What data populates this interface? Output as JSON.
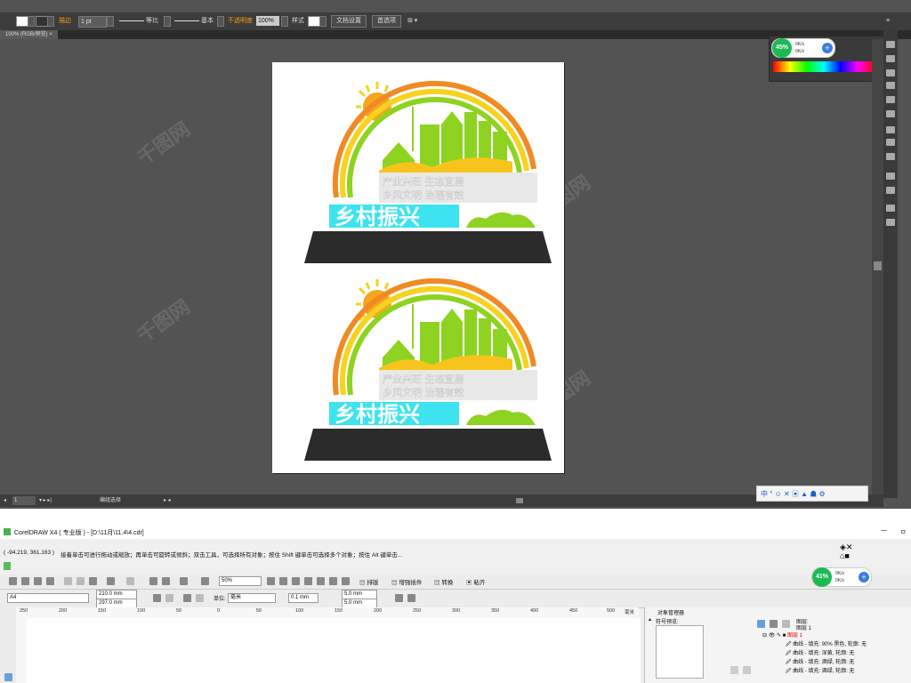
{
  "illustrator": {
    "control_bar": {
      "stroke_label": "描边",
      "stroke_weight": "1 pt",
      "profile_label": "等比",
      "brush_label": "基本",
      "opacity_label": "不透明度",
      "opacity_value": "100%",
      "style_label": "样式",
      "doc_setup_label": "文档设置",
      "prefs_label": "首选项"
    },
    "doc_tab": "100% (RGB/预览)",
    "status": {
      "zoom": "1",
      "tool": "编组选择"
    },
    "speed_widget": {
      "percent": "45%",
      "up": "0K/s",
      "down": "0K/s"
    },
    "sysbar_glyphs": "中 ° ☺ ✕ ▣ ▲ ☗ ⚙",
    "artwork": {
      "banner_text": "乡村振兴",
      "slogan_line1": "产业兴旺 生态宜居",
      "slogan_line2": "乡风文明 治理有效"
    }
  },
  "coreldraw": {
    "title": "CorelDRAW X4 ( 专业版 ) - [D:\\11月\\11.4\\4.cdr]",
    "status_coords": "( -94.219, 361.163 )",
    "status_hint": "接着单击可进行拖动或缩放；再单击可旋转或倾斜；双击工具，可选择所有对象；按住 Shift 键单击可选择多个对象；按住 Alt 键单击...",
    "toolbar": {
      "zoom": "50%",
      "arrange_label": "排版",
      "enhance_label": "增强插件",
      "convert_label": "转换",
      "paste_label": "粘齐"
    },
    "property_bar": {
      "paper": "A4",
      "width": "210.0 mm",
      "height": "297.0 mm",
      "unit_label": "单位:",
      "unit": "毫米",
      "nudge": "0.1 mm",
      "dup_x": "5.0 mm",
      "dup_y": "5.0 mm"
    },
    "ruler_ticks": [
      "250",
      "200",
      "150",
      "100",
      "50",
      "0",
      "50",
      "100",
      "150",
      "200",
      "250",
      "300",
      "350",
      "400",
      "450",
      "500"
    ],
    "ruler_unit": "毫米",
    "speed_widget": {
      "percent": "41%",
      "up": "0K/s",
      "down": "0K/s"
    },
    "object_manager": {
      "title": "对象管理器",
      "symbol_preview": "符号预览:",
      "layer_header": "图层:",
      "layer_sub": "图层 1",
      "layer_name": "图层 1",
      "items": [
        "曲线 - 填充: 90% 黑色, 轮廓: 无",
        "曲线 - 填充: 深黄, 轮廓: 无",
        "曲线 - 填充: 酒绿, 轮廓: 无",
        "曲线 - 填充: 酒绿, 轮廓: 无"
      ]
    },
    "window_controls": {
      "minimize": "—",
      "restore": "ㅁ"
    }
  },
  "colors": {
    "ai_bg": "#535353",
    "orange": "#f08a24",
    "green": "#8ed321",
    "yellow": "#f7d21e",
    "cyan": "#3de3ef",
    "dark_base": "#2b2b2b"
  }
}
